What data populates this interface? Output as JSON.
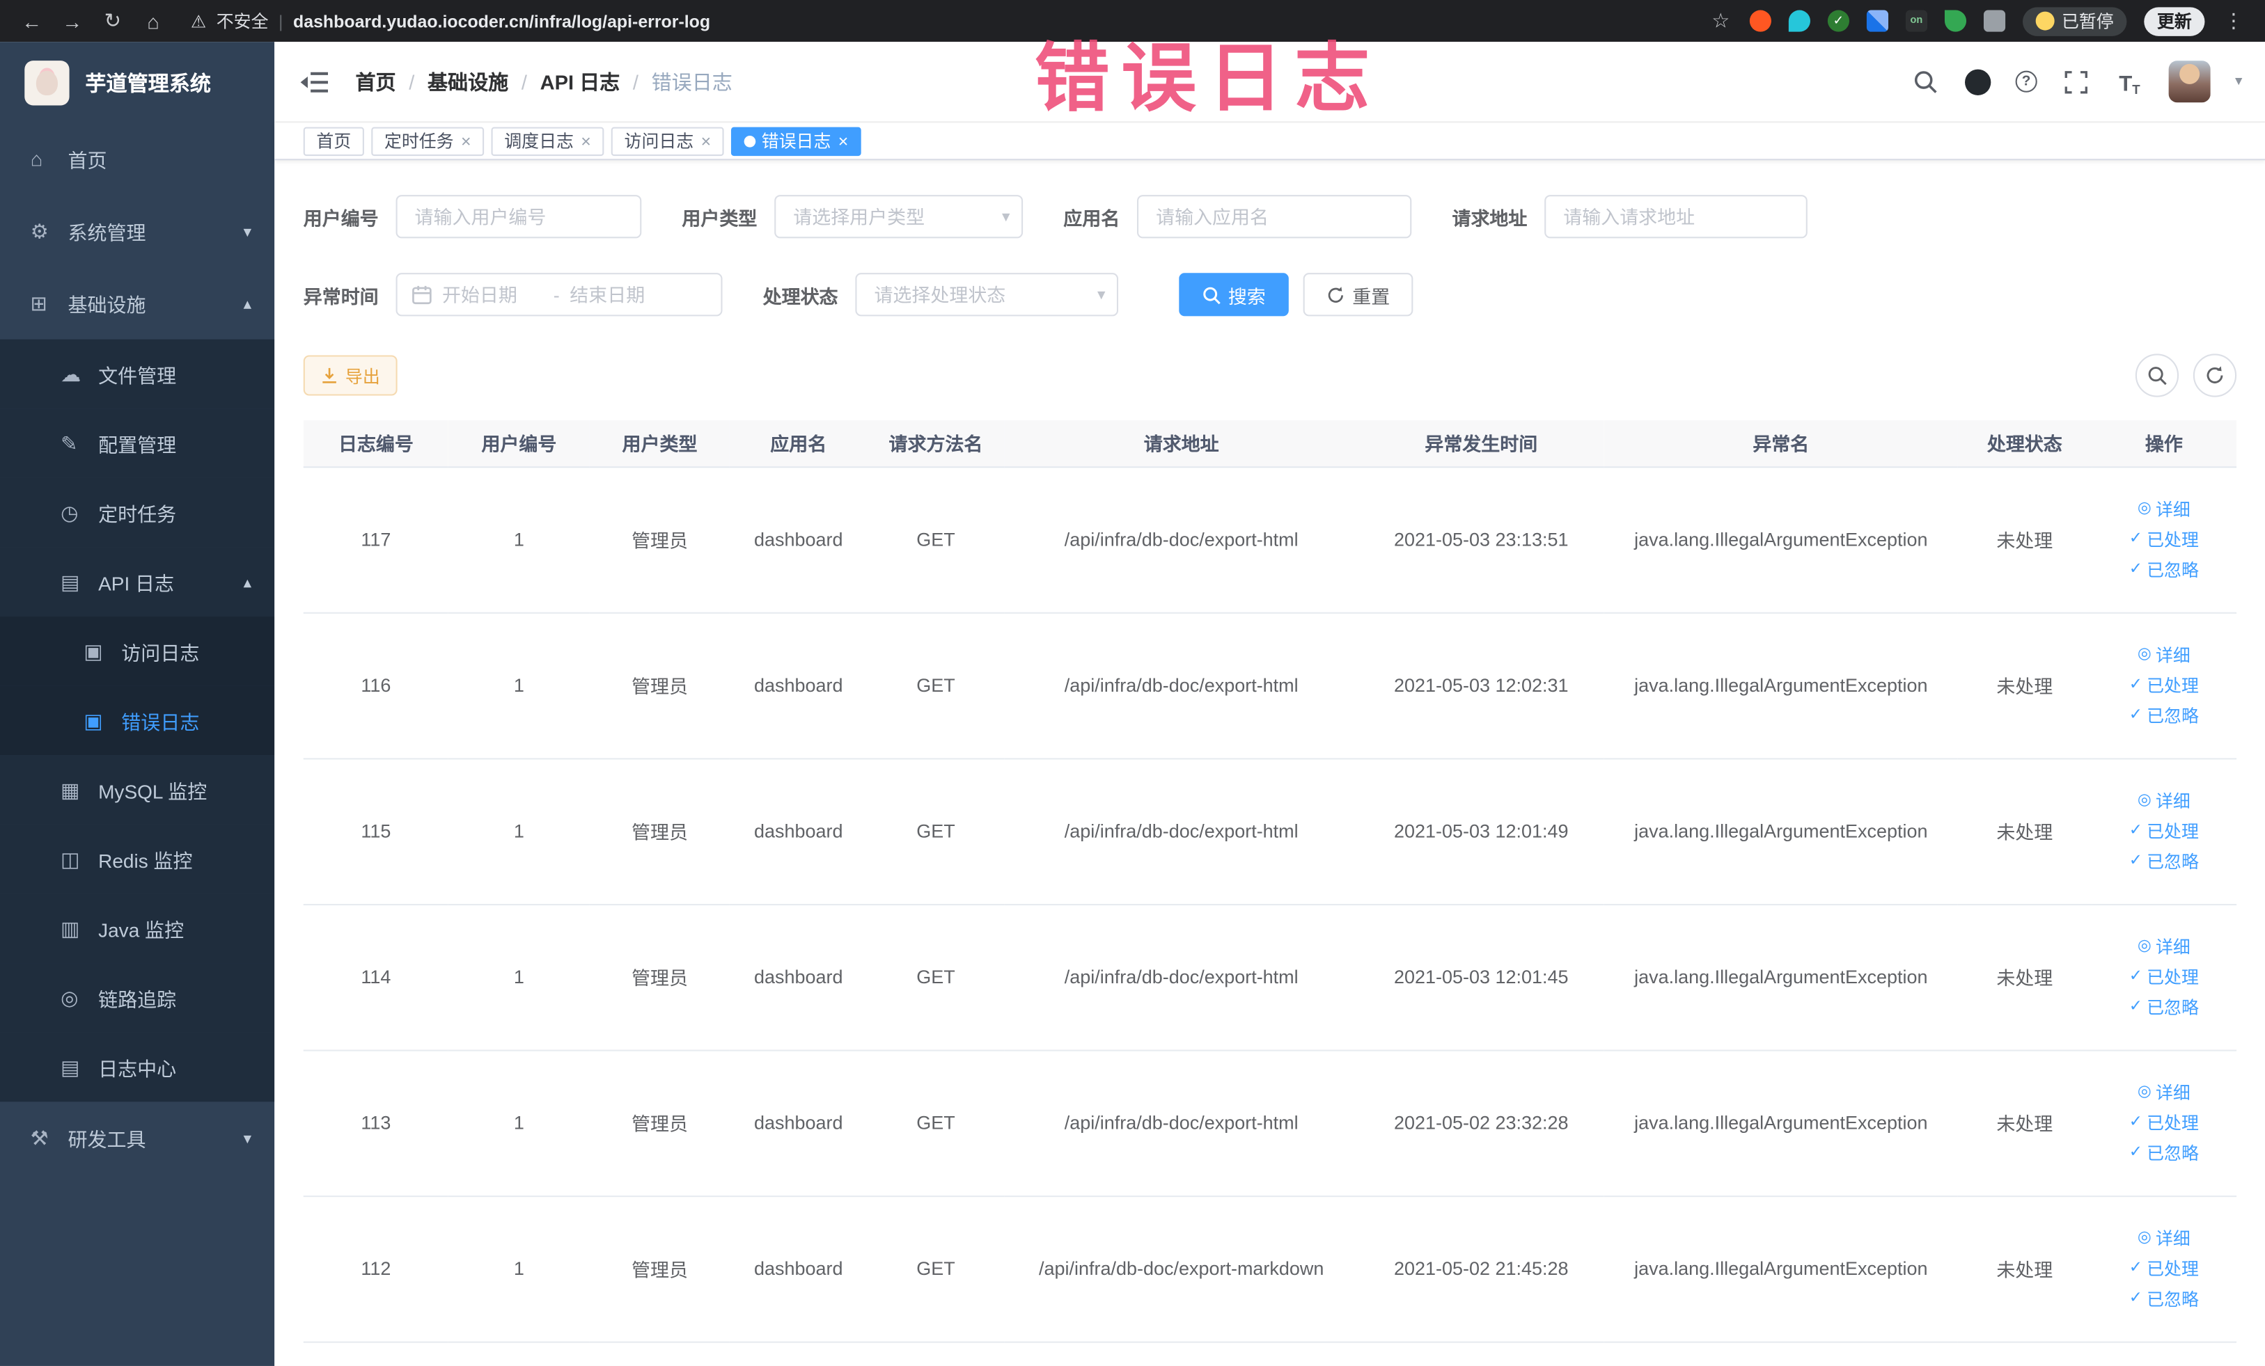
{
  "colors": {
    "accent": "#409eff",
    "warning": "#e6a23c",
    "sidebar_bg": "#304156",
    "submenu_bg": "#1f2d3d",
    "annotation": "#ee4b78",
    "browser_chrome_bg": "#202124"
  },
  "annotation": "错误日志",
  "browser": {
    "security_label": "不安全",
    "url": "dashboard.yudao.iocoder.cn/infra/log/api-error-log",
    "extension_badge": "on",
    "paused_label": "已暂停",
    "update_label": "更新"
  },
  "sidebar": {
    "logo_title": "芋道管理系统",
    "items": [
      {
        "name": "home",
        "label": "首页",
        "icon": "home-icon",
        "level": 1
      },
      {
        "name": "system-management",
        "label": "系统管理",
        "icon": "system-icon",
        "level": 1,
        "arrow": "down"
      },
      {
        "name": "infrastructure",
        "label": "基础设施",
        "icon": "infra-icon",
        "level": 1,
        "arrow": "up"
      },
      {
        "name": "file-management",
        "label": "文件管理",
        "icon": "file-icon",
        "level": 2
      },
      {
        "name": "config-management",
        "label": "配置管理",
        "icon": "config-icon",
        "level": 2
      },
      {
        "name": "scheduled-jobs",
        "label": "定时任务",
        "icon": "job-icon",
        "level": 2
      },
      {
        "name": "api-logs",
        "label": "API 日志",
        "icon": "api-log-icon",
        "level": 2,
        "arrow": "up"
      },
      {
        "name": "access-log",
        "label": "访问日志",
        "icon": "access-log-icon",
        "level": 3
      },
      {
        "name": "error-log",
        "label": "错误日志",
        "icon": "error-log-icon",
        "level": 3,
        "active": true
      },
      {
        "name": "mysql-monitor",
        "label": "MySQL 监控",
        "icon": "mysql-icon",
        "level": 2
      },
      {
        "name": "redis-monitor",
        "label": "Redis 监控",
        "icon": "redis-icon",
        "level": 2
      },
      {
        "name": "java-monitor",
        "label": "Java 监控",
        "icon": "java-icon",
        "level": 2
      },
      {
        "name": "link-tracing",
        "label": "链路追踪",
        "icon": "trace-icon",
        "level": 2
      },
      {
        "name": "log-center",
        "label": "日志中心",
        "icon": "log-center-icon",
        "level": 2
      },
      {
        "name": "dev-tools",
        "label": "研发工具",
        "icon": "devtools-icon",
        "level": 1,
        "arrow": "down"
      }
    ]
  },
  "header": {
    "breadcrumb": [
      "首页",
      "基础设施",
      "API 日志",
      "错误日志"
    ]
  },
  "tabs": [
    {
      "name": "home",
      "label": "首页",
      "closable": false,
      "active": false
    },
    {
      "name": "scheduled-jobs",
      "label": "定时任务",
      "closable": true,
      "active": false
    },
    {
      "name": "schedule-log",
      "label": "调度日志",
      "closable": true,
      "active": false
    },
    {
      "name": "access-log",
      "label": "访问日志",
      "closable": true,
      "active": false
    },
    {
      "name": "error-log",
      "label": "错误日志",
      "closable": true,
      "active": true
    }
  ],
  "filters": {
    "user_id": {
      "label": "用户编号",
      "placeholder": "请输入用户编号"
    },
    "user_type": {
      "label": "用户类型",
      "placeholder": "请选择用户类型"
    },
    "app_name": {
      "label": "应用名",
      "placeholder": "请输入应用名"
    },
    "request_url": {
      "label": "请求地址",
      "placeholder": "请输入请求地址"
    },
    "exception_time": {
      "label": "异常时间",
      "start_placeholder": "开始日期",
      "separator": "-",
      "end_placeholder": "结束日期"
    },
    "process_status": {
      "label": "处理状态",
      "placeholder": "请选择处理状态"
    },
    "search_label": "搜索",
    "reset_label": "重置"
  },
  "toolbar": {
    "export_label": "导出"
  },
  "table": {
    "columns": [
      {
        "key": "id",
        "label": "日志编号"
      },
      {
        "key": "user_id",
        "label": "用户编号"
      },
      {
        "key": "user_type",
        "label": "用户类型"
      },
      {
        "key": "app_name",
        "label": "应用名"
      },
      {
        "key": "method",
        "label": "请求方法名"
      },
      {
        "key": "url",
        "label": "请求地址"
      },
      {
        "key": "time",
        "label": "异常发生时间"
      },
      {
        "key": "exception",
        "label": "异常名"
      },
      {
        "key": "status",
        "label": "处理状态"
      },
      {
        "key": "actions",
        "label": "操作"
      }
    ],
    "row_actions": [
      {
        "name": "detail",
        "icon": "eye-icon",
        "label": "详细"
      },
      {
        "name": "processed",
        "icon": "check-icon",
        "label": "已处理"
      },
      {
        "name": "ignored",
        "icon": "check-icon",
        "label": "已忽略"
      }
    ],
    "rows": [
      {
        "id": "117",
        "user_id": "1",
        "user_type": "管理员",
        "app_name": "dashboard",
        "method": "GET",
        "url": "/api/infra/db-doc/export-html",
        "time": "2021-05-03 23:13:51",
        "exception": "java.lang.IllegalArgumentException",
        "status": "未处理"
      },
      {
        "id": "116",
        "user_id": "1",
        "user_type": "管理员",
        "app_name": "dashboard",
        "method": "GET",
        "url": "/api/infra/db-doc/export-html",
        "time": "2021-05-03 12:02:31",
        "exception": "java.lang.IllegalArgumentException",
        "status": "未处理"
      },
      {
        "id": "115",
        "user_id": "1",
        "user_type": "管理员",
        "app_name": "dashboard",
        "method": "GET",
        "url": "/api/infra/db-doc/export-html",
        "time": "2021-05-03 12:01:49",
        "exception": "java.lang.IllegalArgumentException",
        "status": "未处理"
      },
      {
        "id": "114",
        "user_id": "1",
        "user_type": "管理员",
        "app_name": "dashboard",
        "method": "GET",
        "url": "/api/infra/db-doc/export-html",
        "time": "2021-05-03 12:01:45",
        "exception": "java.lang.IllegalArgumentException",
        "status": "未处理"
      },
      {
        "id": "113",
        "user_id": "1",
        "user_type": "管理员",
        "app_name": "dashboard",
        "method": "GET",
        "url": "/api/infra/db-doc/export-html",
        "time": "2021-05-02 23:32:28",
        "exception": "java.lang.IllegalArgumentException",
        "status": "未处理"
      },
      {
        "id": "112",
        "user_id": "1",
        "user_type": "管理员",
        "app_name": "dashboard",
        "method": "GET",
        "url": "/api/infra/db-doc/export-markdown",
        "time": "2021-05-02 21:45:28",
        "exception": "java.lang.IllegalArgumentException",
        "status": "未处理"
      }
    ]
  }
}
